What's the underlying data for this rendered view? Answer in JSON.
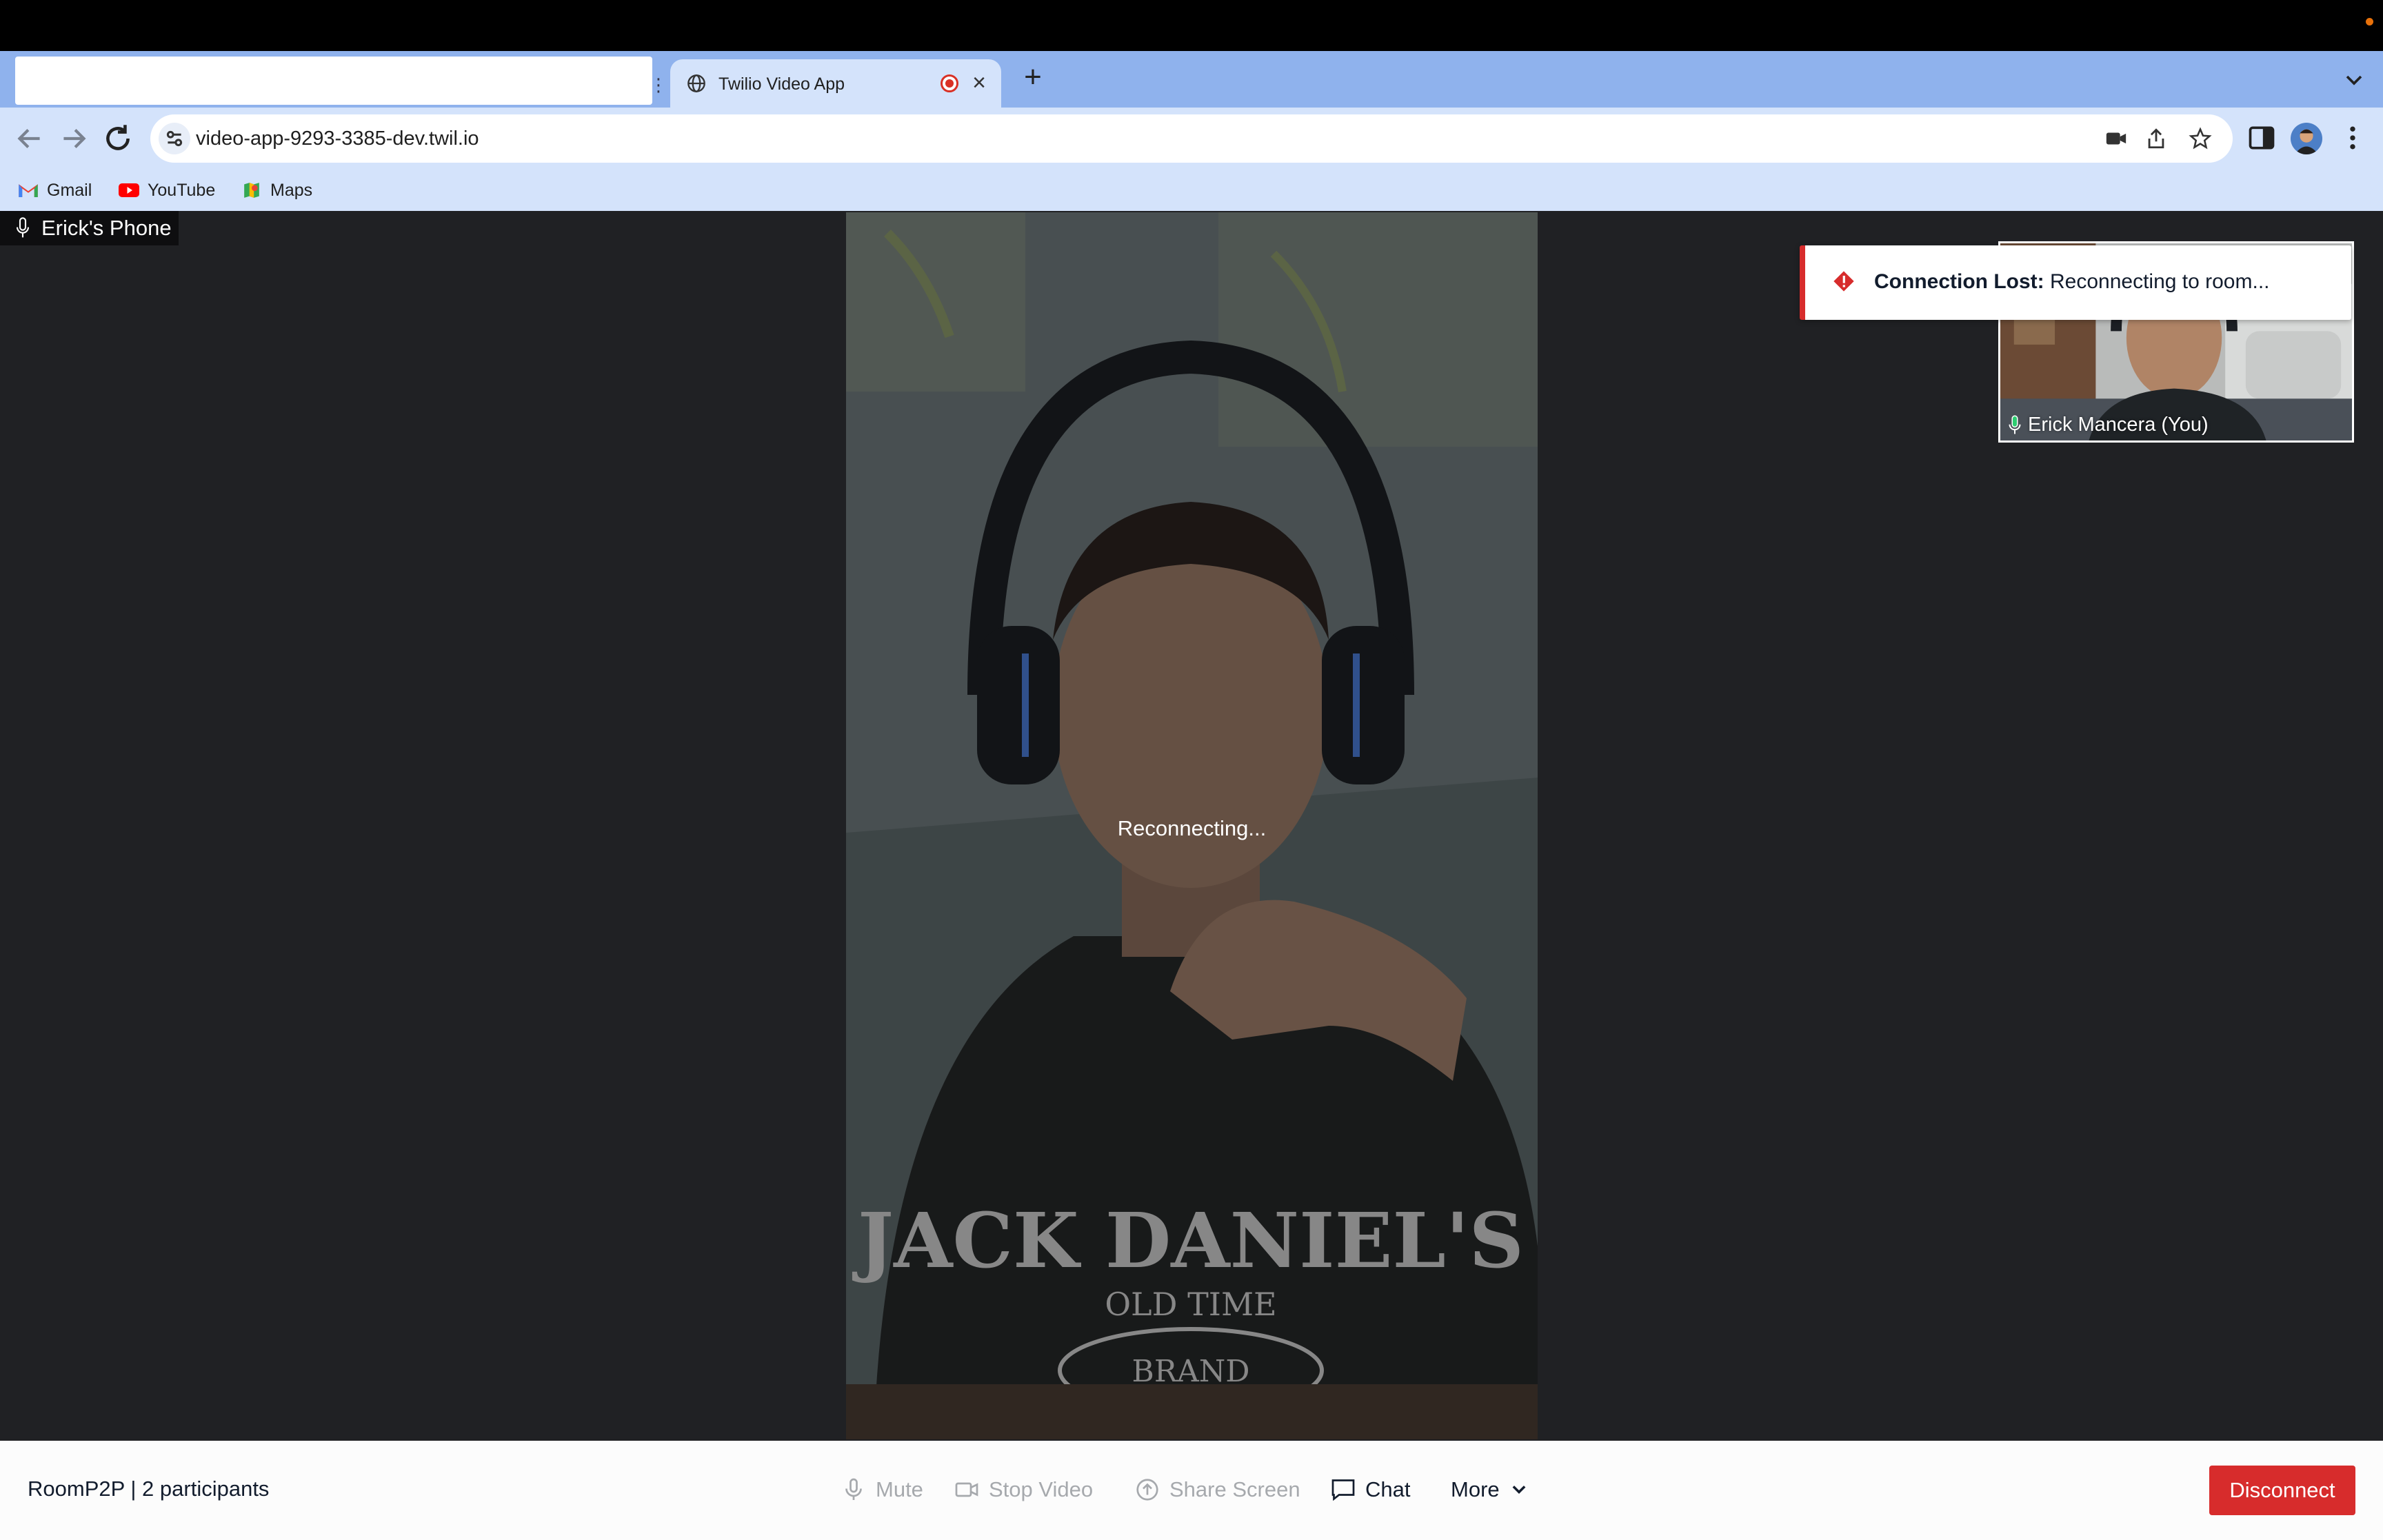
{
  "browser": {
    "tab": {
      "title": "Twilio Video App"
    },
    "address_bar": {
      "url": "video-app-9293-3385-dev.twil.io"
    },
    "bookmarks": [
      {
        "label": "Gmail",
        "icon": "gmail-icon"
      },
      {
        "label": "YouTube",
        "icon": "youtube-icon"
      },
      {
        "label": "Maps",
        "icon": "maps-icon"
      }
    ]
  },
  "main_video": {
    "participant_name": "Erick's Phone",
    "status_text": "Reconnecting..."
  },
  "self_view": {
    "participant_name": "Erick Mancera (You)"
  },
  "toast": {
    "title": "Connection Lost:",
    "message": "Reconnecting to room..."
  },
  "bottom_bar": {
    "room_name": "RoomP2P",
    "separator": "|",
    "participants": "2 participants",
    "controls": {
      "mute": "Mute",
      "stop_video": "Stop Video",
      "share_screen": "Share Screen",
      "chat": "Chat",
      "more": "More"
    },
    "disconnect": "Disconnect"
  },
  "colors": {
    "tabstrip": "#8fb2ed",
    "toolbar": "#d4e3fb",
    "stage": "#202124",
    "danger": "#d72c2c"
  }
}
